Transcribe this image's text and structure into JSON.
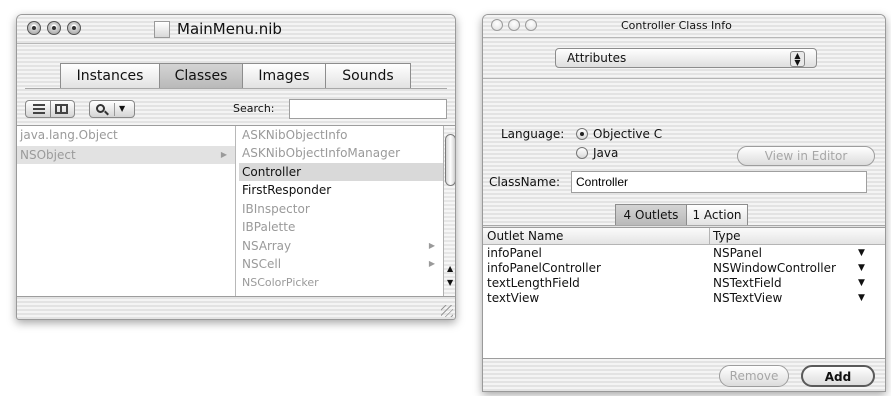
{
  "left_window": {
    "title": "MainMenu.nib",
    "tabs": [
      {
        "label": "Instances",
        "selected": false
      },
      {
        "label": "Classes",
        "selected": true
      },
      {
        "label": "Images",
        "selected": false
      },
      {
        "label": "Sounds",
        "selected": false
      }
    ],
    "toolbar": {
      "list_view_icon": "list-view-icon",
      "column_view_icon": "column-view-icon",
      "search_menu_icon": "magnifier-icon",
      "search_label": "Search:",
      "search_value": ""
    },
    "column1": [
      "java.lang.Object",
      "NSObject"
    ],
    "column2": [
      "ASKNibObjectInfo",
      "ASKNibObjectInfoManager",
      "Controller",
      "FirstResponder",
      "IBInspector",
      "IBPalette",
      "NSArray",
      "NSCell",
      "NSColorPicker"
    ]
  },
  "right_window": {
    "title": "Controller Class Info",
    "popup_label": "Attributes",
    "language_label": "Language:",
    "language_options": [
      {
        "label": "Objective C",
        "selected": true
      },
      {
        "label": "Java",
        "selected": false
      }
    ],
    "view_in_editor_label": "View in Editor",
    "classname_label": "ClassName:",
    "classname_value": "Controller",
    "tabs": [
      {
        "label": "4 Outlets",
        "selected": true
      },
      {
        "label": "1 Action",
        "selected": false
      }
    ],
    "outlet_columns": [
      "Outlet Name",
      "Type"
    ],
    "outlets": [
      {
        "name": "infoPanel",
        "type": "NSPanel"
      },
      {
        "name": "infoPanelController",
        "type": "NSWindowController"
      },
      {
        "name": "textLengthField",
        "type": "NSTextField"
      },
      {
        "name": "textView",
        "type": "NSTextView"
      }
    ],
    "remove_label": "Remove",
    "add_label": "Add"
  }
}
